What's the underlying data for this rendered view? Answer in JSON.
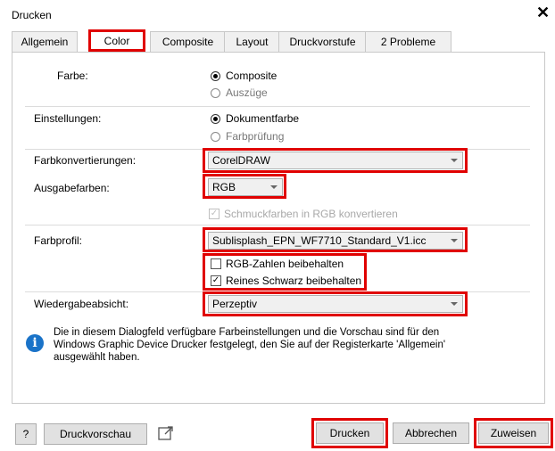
{
  "window": {
    "title": "Drucken",
    "close_glyph": "✕"
  },
  "tabs": [
    "Allgemein",
    "Color",
    "Composite",
    "Layout",
    "Druckvorstufe",
    "2 Probleme"
  ],
  "farbe": {
    "label": "Farbe:",
    "opt1": "Composite",
    "opt2": "Auszüge",
    "selected": "Composite"
  },
  "einstellungen": {
    "label": "Einstellungen:",
    "opt1": "Dokumentfarbe",
    "opt2": "Farbprüfung",
    "selected": "Dokumentfarbe"
  },
  "farbkonvertierungen": {
    "label": "Farbkonvertierungen:",
    "value": "CorelDRAW"
  },
  "ausgabefarben": {
    "label": "Ausgabefarben:",
    "value": "RGB"
  },
  "schmuckfarben": {
    "label": "Schmuckfarben in RGB konvertieren",
    "checked": true,
    "enabled": false
  },
  "farbprofil": {
    "label": "Farbprofil:",
    "value": "Sublisplash_EPN_WF7710_Standard_V1.icc"
  },
  "rgb_zahlen": {
    "label": "RGB-Zahlen beibehalten",
    "checked": false
  },
  "reines_schwarz": {
    "label": "Reines Schwarz beibehalten",
    "checked": true
  },
  "wiedergabe": {
    "label": "Wiedergabeabsicht:",
    "value": "Perzeptiv"
  },
  "info": {
    "text": "Die in diesem Dialogfeld verfügbare Farbeinstellungen und die Vorschau sind für den Windows Graphic Device Drucker festgelegt, den Sie auf der Registerkarte 'Allgemein' ausgewählt haben."
  },
  "footer": {
    "help": "?",
    "preview": "Druckvorschau",
    "print": "Drucken",
    "cancel": "Abbrechen",
    "apply": "Zuweisen"
  },
  "colors": {
    "highlight": "#e00000",
    "info": "#1a73c8"
  }
}
